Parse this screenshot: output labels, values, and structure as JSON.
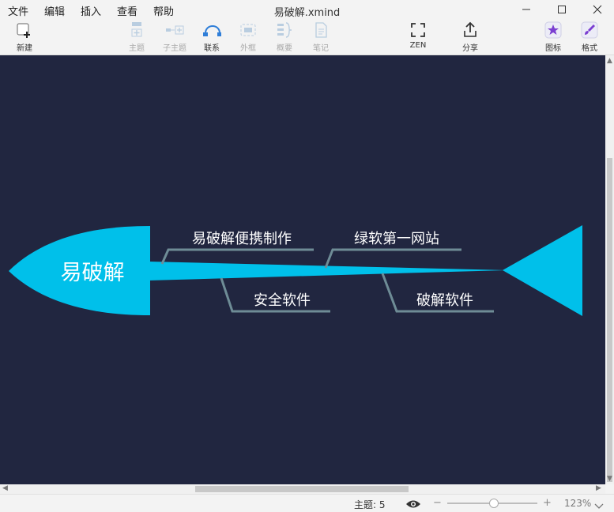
{
  "menu": [
    "文件",
    "编辑",
    "插入",
    "查看",
    "帮助"
  ],
  "window": {
    "title": "易破解.xmind"
  },
  "toolbar": {
    "new": "新建",
    "topic": "主题",
    "subtopic": "子主题",
    "relationship": "联系",
    "boundary": "外框",
    "summary": "概要",
    "notes": "笔记",
    "zen": "ZEN",
    "share": "分享",
    "icons": "图标",
    "format": "格式"
  },
  "mindmap": {
    "central_topic": "易破解",
    "topics": [
      "易破解便携制作",
      "绿软第一网站",
      "安全软件",
      "破解软件"
    ],
    "colors": {
      "background": "#212640",
      "fish": "#00c0ea",
      "branch": "#6e8c96",
      "topic_text": "#ffffff"
    }
  },
  "status": {
    "topic_count": "主题: 5",
    "zoom": "123%"
  }
}
